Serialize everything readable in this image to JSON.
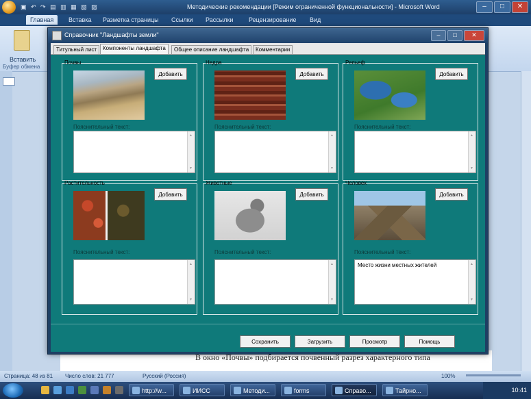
{
  "word": {
    "title": "Методические рекомендации [Режим ограниченной функциональности] - Microsoft Word",
    "tabs": [
      "Главная",
      "Вставка",
      "Разметка страницы",
      "Ссылки",
      "Рассылки",
      "Рецензирование",
      "Вид"
    ],
    "paste_label": "Вставить",
    "clipboard_group": "Буфер обмена",
    "doc_text": "В окно «Почвы» подбирается почвенный разрез характерного типа",
    "status": {
      "page": "Страница: 48 из 81",
      "words": "Число слов: 21 777",
      "language": "Русский (Россия)",
      "zoom": "100%"
    }
  },
  "dialog": {
    "title": "Справочник \"Ландшафты земли\"",
    "tabs": [
      "Титульный лист",
      "Компоненты ландшафта",
      "Общее описание ландшафта",
      "Комментарии"
    ],
    "add_label": "Добавить",
    "caption": "Пояснительный текст:",
    "panels": [
      {
        "name": "Почвы",
        "text": ""
      },
      {
        "name": "Недра",
        "text": ""
      },
      {
        "name": "Рельеф",
        "text": ""
      },
      {
        "name": "Растительность",
        "text": ""
      },
      {
        "name": "Животные",
        "text": ""
      },
      {
        "name": "Человек",
        "text": "Место жизни местных жителей"
      }
    ],
    "buttons": {
      "save": "Сохранить",
      "load": "Загрузить",
      "preview": "Просмотр",
      "help": "Помощь"
    }
  },
  "taskbar": {
    "items": [
      "http://w...",
      "ИИСС",
      "Методи...",
      "forms",
      "Справо...",
      "Тайрно..."
    ],
    "clock": "10:41"
  }
}
